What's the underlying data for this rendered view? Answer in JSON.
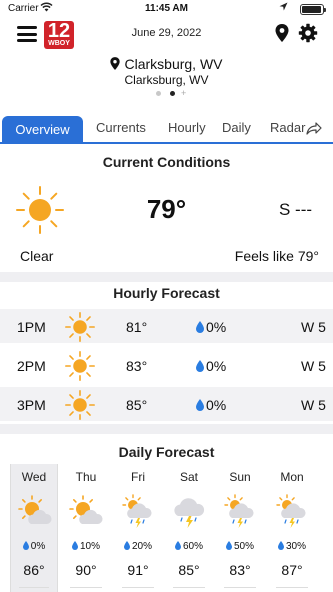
{
  "status_bar": {
    "carrier": "Carrier",
    "time": "11:45 AM"
  },
  "header": {
    "date": "June 29, 2022",
    "logo_number": "12",
    "logo_brand": "WBOY"
  },
  "location": {
    "name": "Clarksburg, WV",
    "subname": "Clarksburg, WV"
  },
  "tabs": [
    {
      "label": "Overview"
    },
    {
      "label": "Currents"
    },
    {
      "label": "Hourly"
    },
    {
      "label": "Daily"
    },
    {
      "label": "Radar"
    }
  ],
  "current_conditions": {
    "title": "Current Conditions",
    "temperature": "79°",
    "wind": "S ---",
    "condition": "Clear",
    "feels_like": "Feels like 79°",
    "icon": "sun-icon"
  },
  "hourly_forecast": {
    "title": "Hourly Forecast",
    "rows": [
      {
        "time": "1PM",
        "temp": "81°",
        "precip": "0%",
        "wind": "W 5",
        "icon": "sun-icon"
      },
      {
        "time": "2PM",
        "temp": "83°",
        "precip": "0%",
        "wind": "W 5",
        "icon": "sun-icon"
      },
      {
        "time": "3PM",
        "temp": "85°",
        "precip": "0%",
        "wind": "W 5",
        "icon": "sun-icon"
      }
    ]
  },
  "daily_forecast": {
    "title": "Daily Forecast",
    "days": [
      {
        "day": "Wed",
        "precip": "0%",
        "temp": "86°",
        "icon": "partly-cloudy-icon"
      },
      {
        "day": "Thu",
        "precip": "10%",
        "temp": "90°",
        "icon": "partly-cloudy-icon"
      },
      {
        "day": "Fri",
        "precip": "20%",
        "temp": "91°",
        "icon": "thunderstorm-sun-icon"
      },
      {
        "day": "Sat",
        "precip": "60%",
        "temp": "85°",
        "icon": "thunderstorm-icon"
      },
      {
        "day": "Sun",
        "precip": "50%",
        "temp": "83°",
        "icon": "thunderstorm-sun-icon"
      },
      {
        "day": "Mon",
        "precip": "30%",
        "temp": "87°",
        "icon": "thunderstorm-sun-icon"
      }
    ]
  },
  "colors": {
    "accent": "#2a6fd6",
    "sun": "#f5a623",
    "logo_red": "#d1232a",
    "drop_blue": "#2a7de1"
  }
}
